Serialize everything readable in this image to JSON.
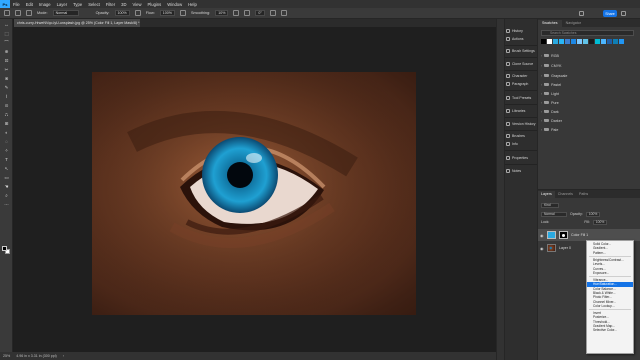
{
  "app": {
    "logo": "Ps"
  },
  "menubar": {
    "items": [
      "File",
      "Edit",
      "Image",
      "Layer",
      "Type",
      "Select",
      "Filter",
      "3D",
      "View",
      "Plugins",
      "Window",
      "Help"
    ]
  },
  "options": {
    "mode_label": "Mode:",
    "mode_value": "Normal",
    "opacity_label": "Opacity:",
    "opacity_value": "100%",
    "flow_label": "Flow:",
    "flow_value": "100%",
    "smoothing_label": "Smoothing:",
    "smoothing_value": "10%",
    "angle_value": "0°",
    "share_label": "Share"
  },
  "document": {
    "tab_title": "chris-curry-HrweNVqo-lyU-unsplash.jpg @ 25% (Color Fill 1, Layer Mask/8) *",
    "close": "×"
  },
  "status": {
    "zoom": "25%",
    "size": "4.96 in x 3.31 in (300 ppi)",
    "arrow": "›"
  },
  "toolbar": {
    "tools": [
      "↔",
      "⬚",
      "⌒",
      "⊕",
      "⊡",
      "✂",
      "⊗",
      "✎",
      "⌇",
      "⊙",
      "⎍",
      "⊞",
      "◐",
      "◌",
      "✧",
      "T",
      "↖",
      "▭",
      "☚",
      "⌕",
      "⋯"
    ]
  },
  "panels": {
    "list": [
      {
        "label": "History",
        "icon": "history-icon"
      },
      {
        "label": "Actions",
        "icon": "actions-icon"
      },
      {
        "label": "Brush Settings",
        "icon": "brush-settings-icon"
      },
      {
        "label": "Clone Source",
        "icon": "clone-source-icon"
      },
      {
        "label": "Character",
        "icon": "character-icon"
      },
      {
        "label": "Paragraph",
        "icon": "paragraph-icon"
      },
      {
        "label": "Tool Presets",
        "icon": "tool-presets-icon"
      },
      {
        "label": "Libraries",
        "icon": "libraries-icon"
      },
      {
        "label": "Version History",
        "icon": "version-history-icon"
      },
      {
        "label": "Brushes",
        "icon": "brushes-icon"
      },
      {
        "label": "Info",
        "icon": "info-icon"
      },
      {
        "label": "Properties",
        "icon": "properties-icon"
      },
      {
        "label": "Notes",
        "icon": "notes-icon"
      }
    ]
  },
  "swatches": {
    "tabs": [
      "Swatches",
      "Navigator"
    ],
    "search_placeholder": "Search Swatches",
    "recent": [
      "#000000",
      "#ffffff",
      "#2aa9e0",
      "#29b6f6",
      "#3d7fd1",
      "#1e88e5",
      "#7ec8ff",
      "#61c3e8",
      "#1a1a1a",
      "#00bcd4",
      "#4db6ff",
      "#1f5fa8",
      "#0f7fb5",
      "#2196f3"
    ],
    "folders": [
      "RGB",
      "CMYK",
      "Grayscale",
      "Pastel",
      "Light",
      "Pure",
      "Dark",
      "Darker",
      "Pale"
    ]
  },
  "layers": {
    "tabs": [
      "Layers",
      "Channels",
      "Paths"
    ],
    "kind_label": "Kind",
    "blend_mode": "Normal",
    "opacity_label": "Opacity:",
    "opacity_value": "100%",
    "lock_label": "Lock:",
    "fill_label": "Fill:",
    "fill_value": "100%",
    "items": [
      {
        "name": "Color Fill 1",
        "selected": true
      },
      {
        "name": "Layer 0",
        "selected": false
      }
    ]
  },
  "adjustment_menu": {
    "items": [
      "Solid Color...",
      "Gradient...",
      "Pattern...",
      "",
      "Brightness/Contrast...",
      "Levels...",
      "Curves...",
      "Exposure...",
      "",
      "Vibrance...",
      "Hue/Saturation...",
      "Color Balance...",
      "Black & White...",
      "Photo Filter...",
      "Channel Mixer...",
      "Color Lookup...",
      "",
      "Invert",
      "Posterize...",
      "Threshold...",
      "Gradient Map...",
      "Selective Color..."
    ],
    "highlighted": "Hue/Saturation..."
  }
}
